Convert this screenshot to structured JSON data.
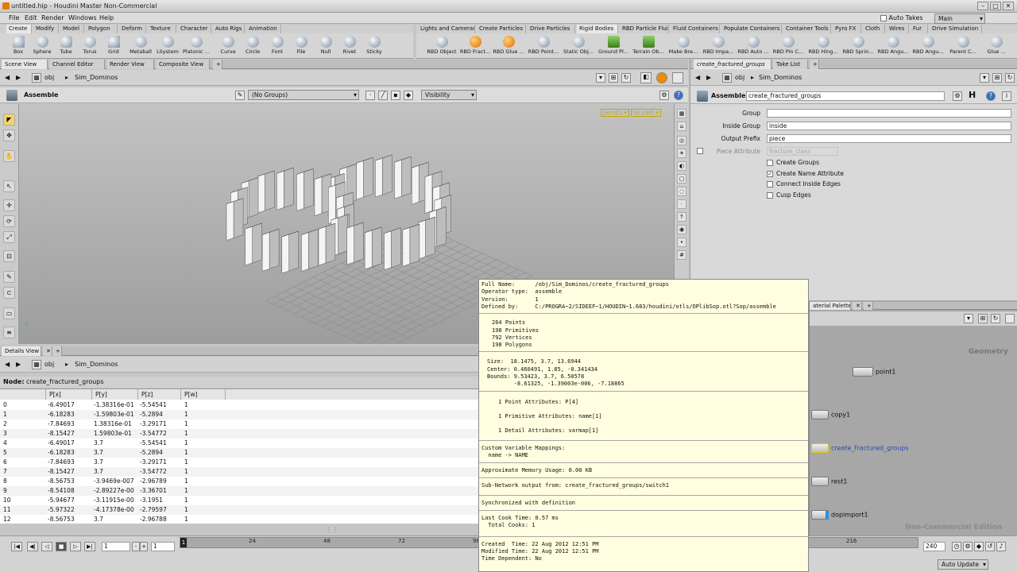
{
  "window": {
    "title": "untitled.hip - Houdini Master Non-Commercial",
    "minimize": "–",
    "maximize": "□",
    "close": "✕"
  },
  "menu": {
    "items": [
      "File",
      "Edit",
      "Render",
      "Windows",
      "Help"
    ],
    "auto_takes": "Auto Takes",
    "take": "Main"
  },
  "shelf_left": {
    "tabs": [
      "Create",
      "Modify",
      "Model",
      "Polygon",
      "Deform",
      "Texture",
      "Character",
      "Auto Rigs",
      "Animation"
    ],
    "tools": [
      "Box",
      "Sphere",
      "Tube",
      "Torus",
      "Grid",
      "Metaball",
      "LSystem",
      "Platonic ...",
      "Curve",
      "Circle",
      "Font",
      "File",
      "Null",
      "Rivet",
      "Sticky"
    ]
  },
  "shelf_right": {
    "tabs": [
      "Lights and Cameras",
      "Create Particles",
      "Drive Particles",
      "Rigid Bodies",
      "RBD Particle Fluids",
      "Fluid Containers",
      "Populate Containers",
      "Container Tools",
      "Pyro FX",
      "Cloth",
      "Wires",
      "Fur",
      "Drive Simulation"
    ],
    "tools": [
      "RBD Object",
      "RBD Fract...",
      "RBD Glue ...",
      "RBD Point...",
      "Static Obj...",
      "Ground Pl...",
      "Terrain Ob...",
      "Make Bre...",
      "RBD Impa...",
      "RBD Auto ...",
      "RBD Pin C...",
      "RBD Hing...",
      "RBD Sprin...",
      "RBD Angu...",
      "RBD Angu...",
      "Parent C...",
      "Glue ..."
    ]
  },
  "scene_panel": {
    "tabs": [
      "Scene View",
      "Channel Editor",
      "Render View",
      "Composite View"
    ],
    "path_root": "obj",
    "path_net": "Sim_Dominos",
    "tool_name": "Assemble",
    "group_dropdown": "(No Groups)",
    "visibility": "Visibility",
    "view_cam": "persp1 ▾",
    "cam_label": "no cam ▾"
  },
  "param_panel": {
    "tabs": [
      "create_fractured_groups",
      "Take List"
    ],
    "path_root": "obj",
    "path_net": "Sim_Dominos",
    "op_type": "Assemble",
    "node_name": "create_fractured_groups",
    "help_h": "H",
    "parms": {
      "group_label": "Group",
      "group_value": "",
      "inside_label": "Inside Group",
      "inside_value": "inside",
      "prefix_label": "Output Prefix",
      "prefix_value": "piece",
      "piece_attr_label": "Piece Attribute",
      "piece_attr_value": "fracture_class"
    },
    "toggles": [
      {
        "label": "Create Groups",
        "checked": false
      },
      {
        "label": "Create Name Attribute",
        "checked": true
      },
      {
        "label": "Connect Inside Edges",
        "checked": false
      },
      {
        "label": "Cusp Edges",
        "checked": false
      }
    ]
  },
  "details_panel": {
    "tab": "Details View",
    "path_root": "obj",
    "path_net": "Sim_Dominos",
    "node_label": "Node:",
    "node_name": "create_fractured_groups",
    "columns": [
      "P[x]",
      "P[y]",
      "P[z]",
      "P[w]"
    ],
    "rows": [
      [
        "0",
        "-6.49017",
        "-1.38316e-01",
        "-5.54541",
        "1"
      ],
      [
        "1",
        "-6.18283",
        "-1.59803e-01",
        "-5.2894",
        "1"
      ],
      [
        "2",
        "-7.84693",
        "1.38316e-01",
        "-3.29171",
        "1"
      ],
      [
        "3",
        "-8.15427",
        "1.59803e-01",
        "-3.54772",
        "1"
      ],
      [
        "4",
        "-6.49017",
        "3.7",
        "-5.54541",
        "1"
      ],
      [
        "5",
        "-6.18283",
        "3.7",
        "-5.2894",
        "1"
      ],
      [
        "6",
        "-7.84693",
        "3.7",
        "-3.29171",
        "1"
      ],
      [
        "7",
        "-8.15427",
        "3.7",
        "-3.54772",
        "1"
      ],
      [
        "8",
        "-8.56753",
        "-3.9469e-007",
        "-2.96789",
        "1"
      ],
      [
        "9",
        "-8.54108",
        "-2.89227e-00",
        "-3.36701",
        "1"
      ],
      [
        "10",
        "-5.94677",
        "-3.11915e-00",
        "-3.1951",
        "1"
      ],
      [
        "11",
        "-5.97322",
        "-4.17378e-00",
        "-2.79597",
        "1"
      ],
      [
        "12",
        "-8.56753",
        "3.7",
        "-2.96788",
        "1"
      ]
    ]
  },
  "info_popup": {
    "lines_header": [
      "Full Name:      /obj/Sim_Dominos/create_fractured_groups",
      "Operator type:  assemble",
      "Version:        1",
      "Defined by:     C:/PROGRA~2/SIDEEF~1/HOUDIN~1.683/houdini/otls/OPlibSop.otl?Sop/assemble"
    ],
    "counts": [
      "264 Points",
      "198 Primitives",
      "792 Vertices",
      "198 Polygons"
    ],
    "bounds": [
      "Size:  18.1475, 3.7, 13.6944",
      "Center: 0.460491, 1.85, -0.341434",
      "Bounds: 9.53423, 3.7, 6.50578",
      "        -8.61325, -1.39003e-006, -7.18865"
    ],
    "attributes": [
      "1 Point Attributes: P[4]",
      "1 Primitive Attributes: name[1]",
      "1 Detail Attributes: varmap[1]"
    ],
    "mappings": [
      "Custom Variable Mappings:",
      "  name -> NAME"
    ],
    "memory": "Approximate Memory Usage: 0.00 KB",
    "subnet": "Sub-Network output from: create_fractured_groups/switch1",
    "sync": "Synchronized with definition",
    "cook": [
      "Last Cook Time: 0.57 ms",
      "  Total Cooks: 1"
    ],
    "times": [
      "Created  Time: 22 Aug 2012 12:51 PM",
      "Modified Time: 22 Aug 2012 12:51 PM",
      "Time Dependent: No"
    ]
  },
  "network": {
    "tab_fragment": "aterial Palette",
    "context": "Geometry",
    "watermark": "Non-Commercial Edition",
    "nodes": [
      "point1",
      "copy1",
      "create_fractured_groups",
      "rest1",
      "dopimport1"
    ]
  },
  "playbar": {
    "frame": "1",
    "start": "1",
    "end_frame": "240",
    "ticks": [
      "24",
      "48",
      "72",
      "96",
      "216"
    ],
    "auto_update": "Auto Update"
  }
}
